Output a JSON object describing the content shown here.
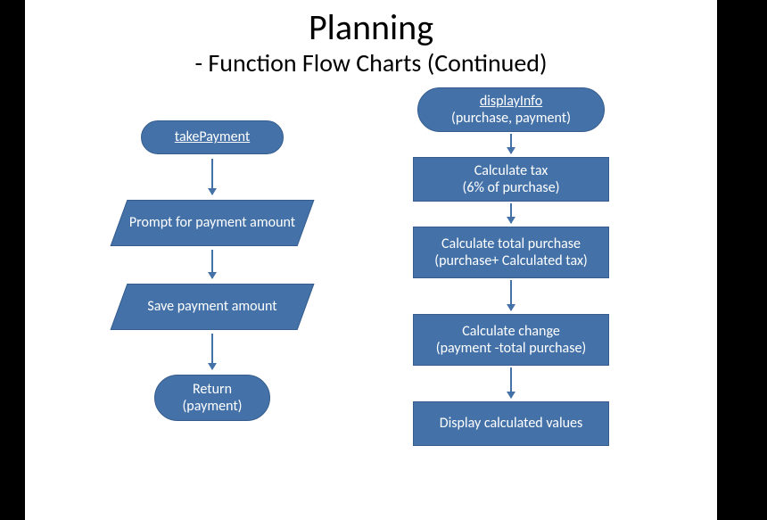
{
  "title": "Planning",
  "subtitle": "- Function Flow Charts (Continued)",
  "left": {
    "start": "takePayment",
    "io1": "Prompt for payment amount",
    "io2": "Save payment amount",
    "end_l1": "Return",
    "end_l2": "(payment)"
  },
  "right": {
    "start_l1": "displayInfo",
    "start_l2": "(purchase, payment)",
    "p1_l1": "Calculate tax",
    "p1_l2": "(6% of purchase)",
    "p2_l1": "Calculate total purchase",
    "p2_l2": "(purchase+ Calculated tax)",
    "p3_l1": "Calculate change",
    "p3_l2": "(payment -total purchase)",
    "p4": "Display calculated values"
  }
}
